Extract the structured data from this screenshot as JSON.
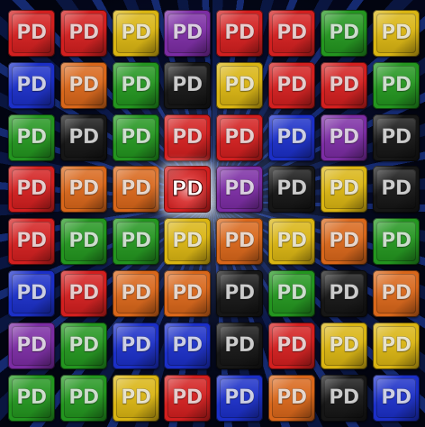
{
  "board": {
    "tile_label": "PD",
    "selected": {
      "row": 3,
      "col": 3
    },
    "colors": {
      "R": "#d21f1f",
      "O": "#d8661a",
      "Y": "#d9b412",
      "P": "#7b2ca3",
      "G": "#23951f",
      "B": "#1b2fc7",
      "K": "#161616"
    },
    "grid": [
      [
        "R",
        "R",
        "Y",
        "P",
        "R",
        "R",
        "G",
        "Y"
      ],
      [
        "B",
        "O",
        "G",
        "K",
        "Y",
        "R",
        "R",
        "G"
      ],
      [
        "G",
        "K",
        "G",
        "R",
        "R",
        "B",
        "P",
        "K"
      ],
      [
        "R",
        "O",
        "O",
        "R",
        "P",
        "K",
        "Y",
        "K"
      ],
      [
        "R",
        "G",
        "G",
        "Y",
        "O",
        "Y",
        "O",
        "G"
      ],
      [
        "B",
        "R",
        "O",
        "O",
        "K",
        "G",
        "K",
        "O"
      ],
      [
        "P",
        "G",
        "B",
        "B",
        "K",
        "R",
        "Y",
        "Y"
      ],
      [
        "G",
        "G",
        "Y",
        "R",
        "B",
        "O",
        "K",
        "B"
      ]
    ]
  }
}
